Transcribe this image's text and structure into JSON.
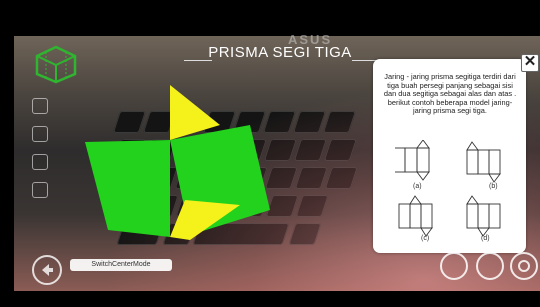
{
  "header": {
    "title": "PRISMA SEGI TIGA"
  },
  "background": {
    "brand_text": "ASUS"
  },
  "info_panel": {
    "description": "Jaring - jaring prisma segitiga terdiri dari tiga buah persegi panjang sebagai sisi dan dua segitiga sebagai alas dan atas . berikut contoh beberapa model jaring-jaring prisma segi tiga.",
    "close_label": "✕",
    "nets": [
      {
        "label": "(a)"
      },
      {
        "label": "(b)"
      },
      {
        "label": "(c)"
      },
      {
        "label": "(d)"
      }
    ]
  },
  "footer": {
    "switch_label": "SwitchCenterMode"
  },
  "colors": {
    "prism_green": "#22d21c",
    "prism_yellow": "#f4f21a",
    "icon_green": "#2fb52f"
  },
  "icons": [
    "cube-menu-icon",
    "close-icon",
    "back-icon",
    "settings-icon"
  ]
}
